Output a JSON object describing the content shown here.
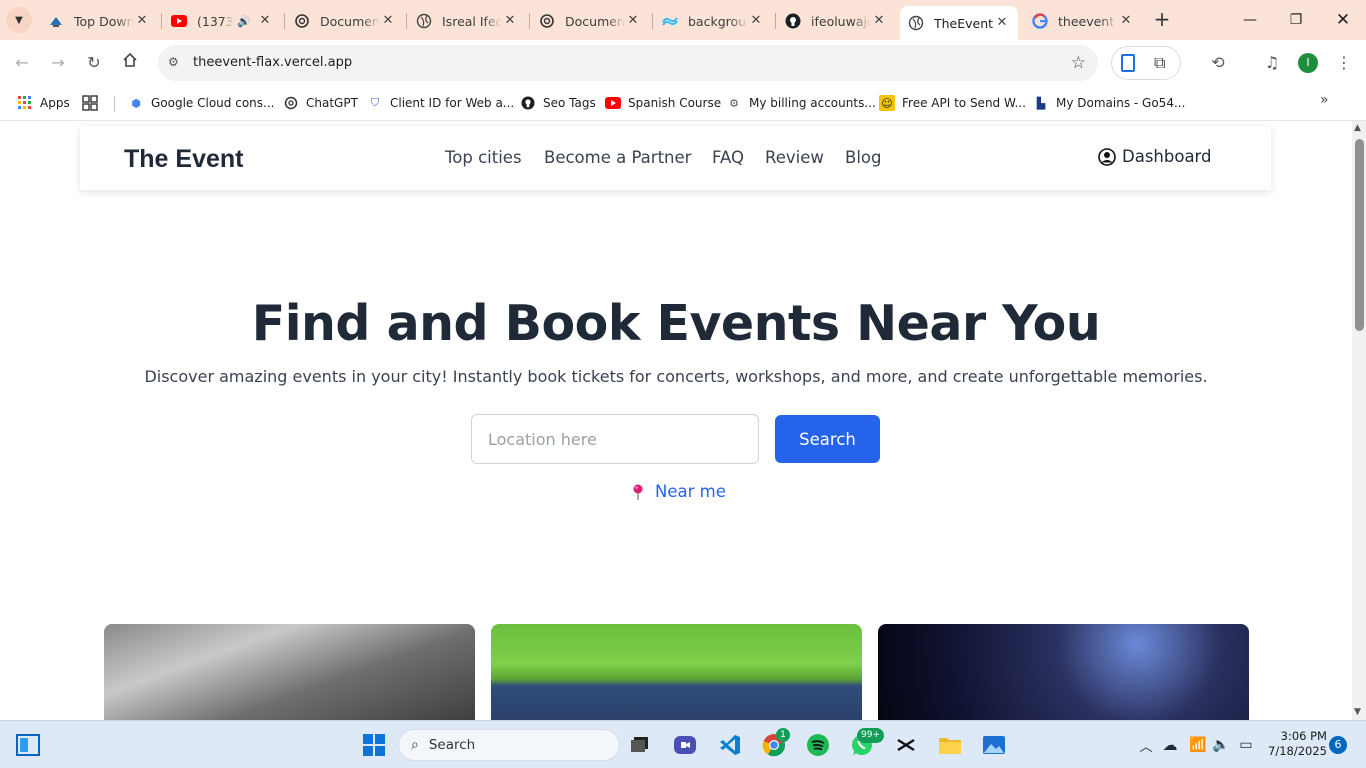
{
  "browser": {
    "tabs": [
      {
        "title": "Top Down",
        "icon": "bird-icon"
      },
      {
        "title": "(1373)",
        "icon": "youtube-icon",
        "audio": true
      },
      {
        "title": "Documen",
        "icon": "chatgpt-icon"
      },
      {
        "title": "Isreal Ifeo",
        "icon": "globe-icon"
      },
      {
        "title": "Documen",
        "icon": "chatgpt-icon"
      },
      {
        "title": "backgrou",
        "icon": "tailwind-icon"
      },
      {
        "title": "ifeoluwajo",
        "icon": "github-icon"
      },
      {
        "title": "TheEvent",
        "icon": "globe-icon",
        "active": true
      },
      {
        "title": "theevent",
        "icon": "google-icon"
      }
    ],
    "url": "theevent-flax.vercel.app",
    "profile_initial": "I",
    "bookmarks": [
      {
        "label": "Apps",
        "icon": "apps-grid-icon"
      },
      {
        "label": "",
        "icon": "apps-icon"
      },
      {
        "label": "Google Cloud cons...",
        "icon": "google-cloud-icon"
      },
      {
        "label": "ChatGPT",
        "icon": "chatgpt-icon"
      },
      {
        "label": "Client ID for Web a...",
        "icon": "shield-icon"
      },
      {
        "label": "Seo Tags",
        "icon": "github-icon"
      },
      {
        "label": "Spanish Course",
        "icon": "youtube-icon"
      },
      {
        "label": "My billing accounts...",
        "icon": "gear-icon"
      },
      {
        "label": "Free API to Send W...",
        "icon": "face-icon"
      },
      {
        "label": "My Domains - Go54...",
        "icon": "bookmark-icon"
      }
    ]
  },
  "site": {
    "brand": "The Event",
    "nav": [
      "Top cities",
      "Become a Partner",
      "FAQ",
      "Review",
      "Blog"
    ],
    "dashboard": "Dashboard",
    "hero_title": "Find and Book Events Near You",
    "hero_subtitle": "Discover amazing events in your city! Instantly book tickets for concerts, workshops, and more, and create unforgettable memories.",
    "search_placeholder": "Location here",
    "search_button": "Search",
    "near_me": "Near me",
    "accent_color": "#2563eb"
  },
  "taskbar": {
    "search_label": "Search",
    "time": "3:06 PM",
    "date": "7/18/2025",
    "notification_count": "6",
    "whatsapp_badge": "99+",
    "chrome_badge": "1"
  }
}
